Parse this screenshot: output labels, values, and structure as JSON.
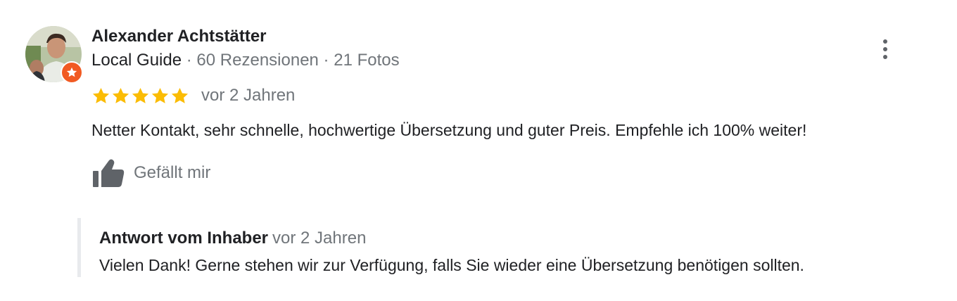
{
  "review": {
    "author": {
      "name": "Alexander Achtstätter",
      "badge": "Local Guide",
      "separator": " · ",
      "reviews_count": "60 Rezensionen",
      "photos_count": "21 Fotos",
      "avatar_icon": "user-photo-avatar",
      "badge_icon": "local-guide-star-badge"
    },
    "rating": {
      "stars": 5,
      "max_stars": 5,
      "date": "vor 2 Jahren",
      "star_color": "#fbbc04"
    },
    "text": "Netter Kontakt, sehr schnelle, hochwertige Übersetzung und guter Preis. Empfehle ich 100% weiter!",
    "like": {
      "label": "Gefällt mir",
      "icon": "thumbs-up-icon"
    },
    "more_icon": "more-vert-icon",
    "owner_reply": {
      "title": "Antwort vom Inhaber",
      "date": "vor 2 Jahren",
      "text": "Vielen Dank! Gerne stehen wir zur Verfügung, falls Sie wieder eine Übersetzung benötigen sollten."
    }
  },
  "colors": {
    "primary_text": "#202124",
    "secondary_text": "#70757a",
    "local_guide_orange": "#f15a22",
    "reply_border": "#e8eaed"
  }
}
